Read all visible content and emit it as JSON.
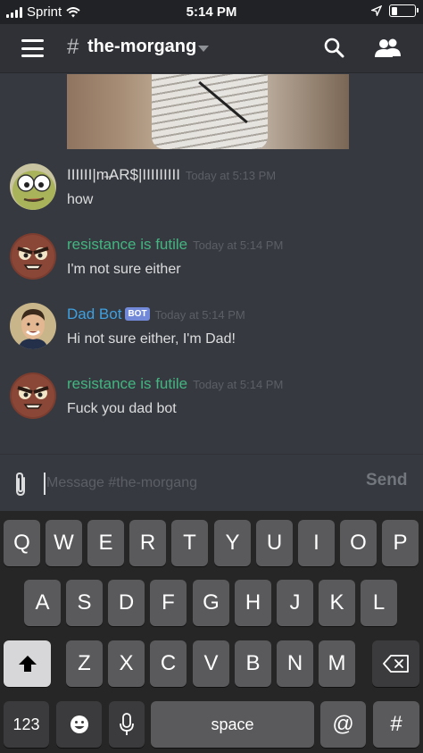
{
  "status_bar": {
    "carrier": "Sprint",
    "time": "5:14 PM"
  },
  "header": {
    "hash": "#",
    "channel_name": "the-morgang"
  },
  "messages": [
    {
      "author": "IIIIII|m̶AR$|IIIIIIIII",
      "author_color": "#ffffff",
      "timestamp": "Today at 5:13 PM",
      "text": "how",
      "bot": ""
    },
    {
      "author": "resistance is futile",
      "author_color": "#43b581",
      "timestamp": "Today at 5:14 PM",
      "text": "I'm not sure either",
      "bot": ""
    },
    {
      "author": "Dad Bot",
      "author_color": "#3fa0e0",
      "timestamp": "Today at 5:14 PM",
      "text": "Hi not sure either, I'm Dad!",
      "bot": "BOT"
    },
    {
      "author": "resistance is futile",
      "author_color": "#43b581",
      "timestamp": "Today at 5:14 PM",
      "text": "Fuck you dad bot",
      "bot": ""
    }
  ],
  "composer": {
    "placeholder": "Message #the-morgang",
    "send_label": "Send"
  },
  "keyboard": {
    "row1": [
      "Q",
      "W",
      "E",
      "R",
      "T",
      "Y",
      "U",
      "I",
      "O",
      "P"
    ],
    "row2": [
      "A",
      "S",
      "D",
      "F",
      "G",
      "H",
      "J",
      "K",
      "L"
    ],
    "row3": [
      "Z",
      "X",
      "C",
      "V",
      "B",
      "N",
      "M"
    ],
    "numbers_label": "123",
    "space_label": "space",
    "at_label": "@",
    "hash_label": "#"
  }
}
